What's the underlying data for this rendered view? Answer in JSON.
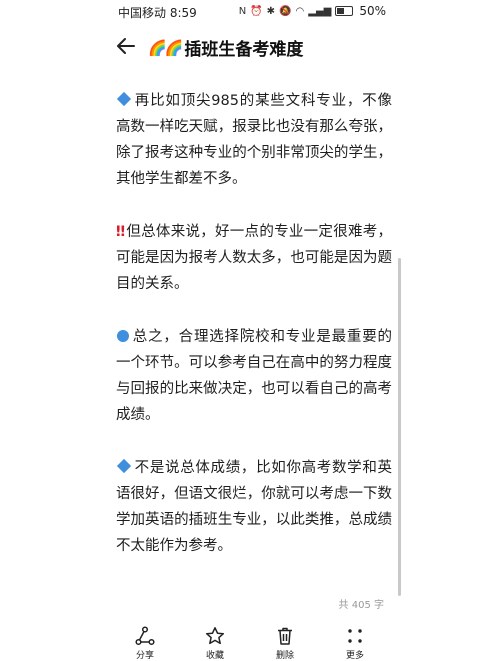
{
  "status_bar": {
    "carrier_time": "中国移动 8:59",
    "battery": "50%"
  },
  "header": {
    "title_emoji": "🌈🌈",
    "title": "插班生备考难度"
  },
  "paragraphs": [
    {
      "icon": "blue-diamond-icon",
      "text": "再比如顶尖985的某些文科专业，不像高数一样吃天赋，报录比也没有那么夸张，除了报考这种专业的个别非常顶尖的学生，其他学生都差不多。"
    },
    {
      "icon": "double-exclamation-icon",
      "text": "但总体来说，好一点的专业一定很难考，可能是因为报考人数太多，也可能是因为题目的关系。"
    },
    {
      "icon": "blue-circle-icon",
      "text": "总之，合理选择院校和专业是最重要的一个环节。可以参考自己在高中的努力程度与回报的比来做决定，也可以看自己的高考成绩。"
    },
    {
      "icon": "blue-diamond-icon",
      "text": "不是说总体成绩，比如你高考数学和英语很好，但语文很烂，你就可以考虑一下数学加英语的插班生专业，以此类推，总成绩不太能作为参考。"
    }
  ],
  "word_count": "共 405 字",
  "toolbar": {
    "share": "分享",
    "favorite": "收藏",
    "delete": "删除",
    "more": "更多"
  }
}
